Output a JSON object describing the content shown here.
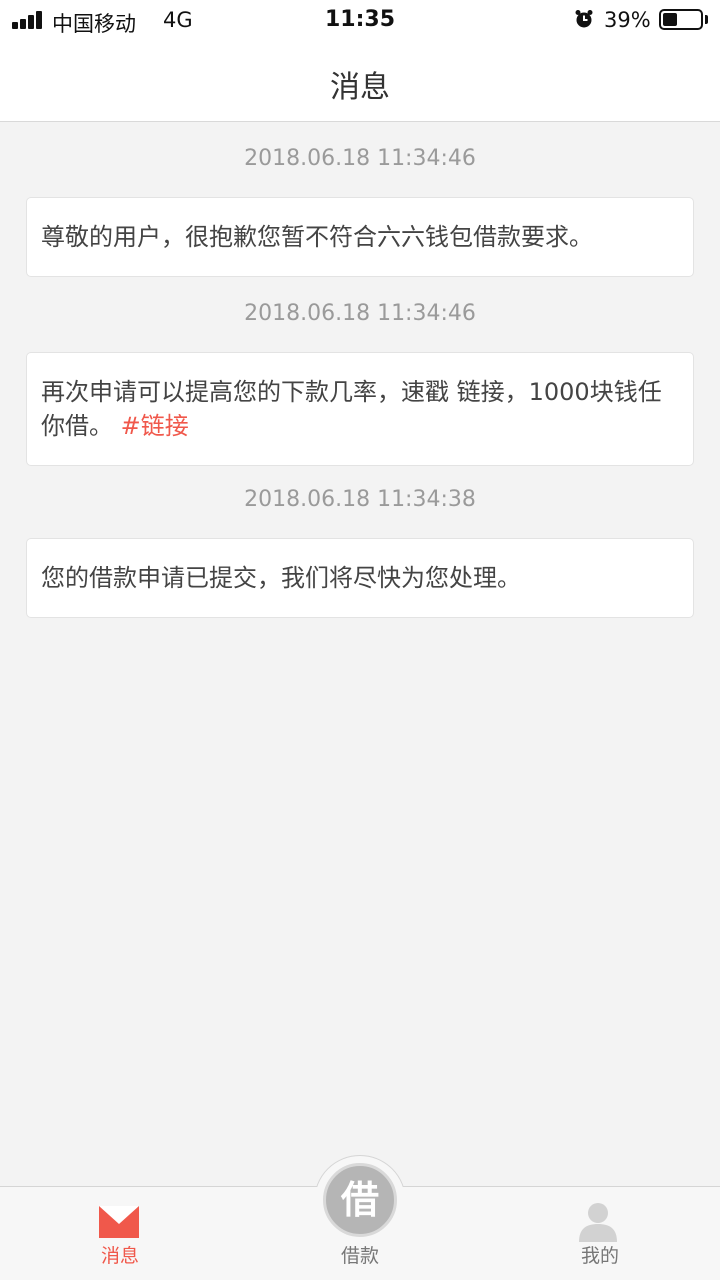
{
  "status_bar": {
    "carrier": "中国移动",
    "network": "4G",
    "time": "11:35",
    "battery": "39%",
    "battery_level": 0.39
  },
  "nav": {
    "title": "消息"
  },
  "messages": [
    {
      "timestamp": "2018.06.18 11:34:46",
      "text": "尊敬的用户，很抱歉您暂不符合六六钱包借款要求。"
    },
    {
      "timestamp": "2018.06.18 11:34:46",
      "text": "再次申请可以提高您的下款几率，速戳 链接，1000块钱任你借。",
      "link": "#链接"
    },
    {
      "timestamp": "2018.06.18 11:34:38",
      "text": "您的借款申请已提交，我们将尽快为您处理。"
    }
  ],
  "tabs": {
    "messages": "消息",
    "borrow": "借款",
    "borrow_icon_char": "借",
    "mine": "我的"
  },
  "colors": {
    "accent": "#f0584b",
    "inactive": "#b5b5b5"
  }
}
